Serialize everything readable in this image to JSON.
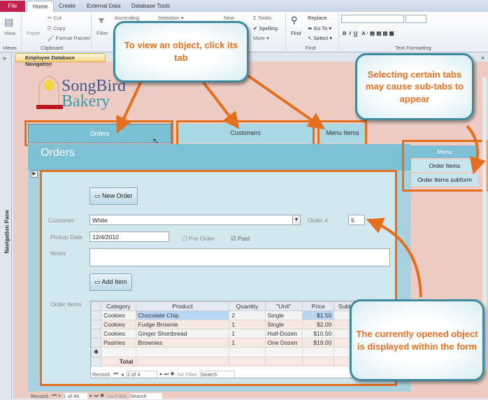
{
  "ribbon": {
    "tabs": [
      "File",
      "Home",
      "Create",
      "External Data",
      "Database Tools"
    ],
    "items": {
      "view": "View",
      "paste": "Paste",
      "cut": "Cut",
      "copy": "Copy",
      "format_painter": "Format Painter",
      "filter": "Filter",
      "ascending": "Ascending",
      "selection": "Selection ▾",
      "new": "New",
      "totals": "Totals",
      "spelling": "Spelling",
      "more": "More ▾",
      "find": "Find",
      "replace": "Replace",
      "goto": "Go To ▾",
      "select": "Select ▾"
    },
    "groups": {
      "views": "Views",
      "clipboard": "Clipboard",
      "find": "Find",
      "text_formatting": "Text Formatting"
    }
  },
  "nav_pane": {
    "label": "Navigation Pane",
    "expand": "»"
  },
  "document_tab": "Employee Database Navigation",
  "logo": {
    "line1": "SongBird",
    "line2": "Bakery"
  },
  "nav_tabs": [
    "Orders",
    "Customers",
    "Menu Items"
  ],
  "sub_tabs": [
    "Menu",
    "Order Items",
    "Order Items  subform"
  ],
  "form": {
    "title": "Orders",
    "new_order": "New Order",
    "customer_label": "Customer",
    "customer_value": "White",
    "order_label": "Order #",
    "order_value": "5",
    "pickup_label": "Pickup Date",
    "pickup_value": "12/4/2010",
    "pre_order": "Pre Order",
    "pre_order_checked": false,
    "paid": "Paid",
    "paid_checked": true,
    "notes_label": "Notes",
    "notes_value": "",
    "add_item": "Add Item",
    "order_items_label": "Order Items"
  },
  "subform": {
    "columns": [
      "Category",
      "Product",
      "Quantity",
      "\"Unit\"",
      "Price",
      "Subt"
    ],
    "rows": [
      [
        "Cookies",
        "Chocolate Chip",
        "2",
        "Single",
        "$1.50"
      ],
      [
        "Cookies",
        "Fudge Brownie",
        "1",
        "Single",
        "$2.00"
      ],
      [
        "Cookies",
        "Ginger Shortbread",
        "1",
        "Half-Dozen",
        "$10.50"
      ],
      [
        "Pastries",
        "Brownies",
        "1",
        "One Dozen",
        "$19.00"
      ]
    ],
    "total_label": "Total",
    "record": "Record:",
    "record_pos": "1 of 4",
    "no_filter": "No Filter",
    "search": "Search"
  },
  "main_record": {
    "record": "Record:",
    "record_pos": "1 of 46",
    "no_filter": "No Filter",
    "search": "Search"
  },
  "callouts": [
    "To view an object, click its tab",
    "Selecting certain tabs may cause sub-tabs to appear",
    "The currently opened object is displayed within the form"
  ],
  "colors": {
    "accent": "#e4701f",
    "tab_active": "#7dc0d3",
    "callout_border": "#3e8a9c"
  }
}
